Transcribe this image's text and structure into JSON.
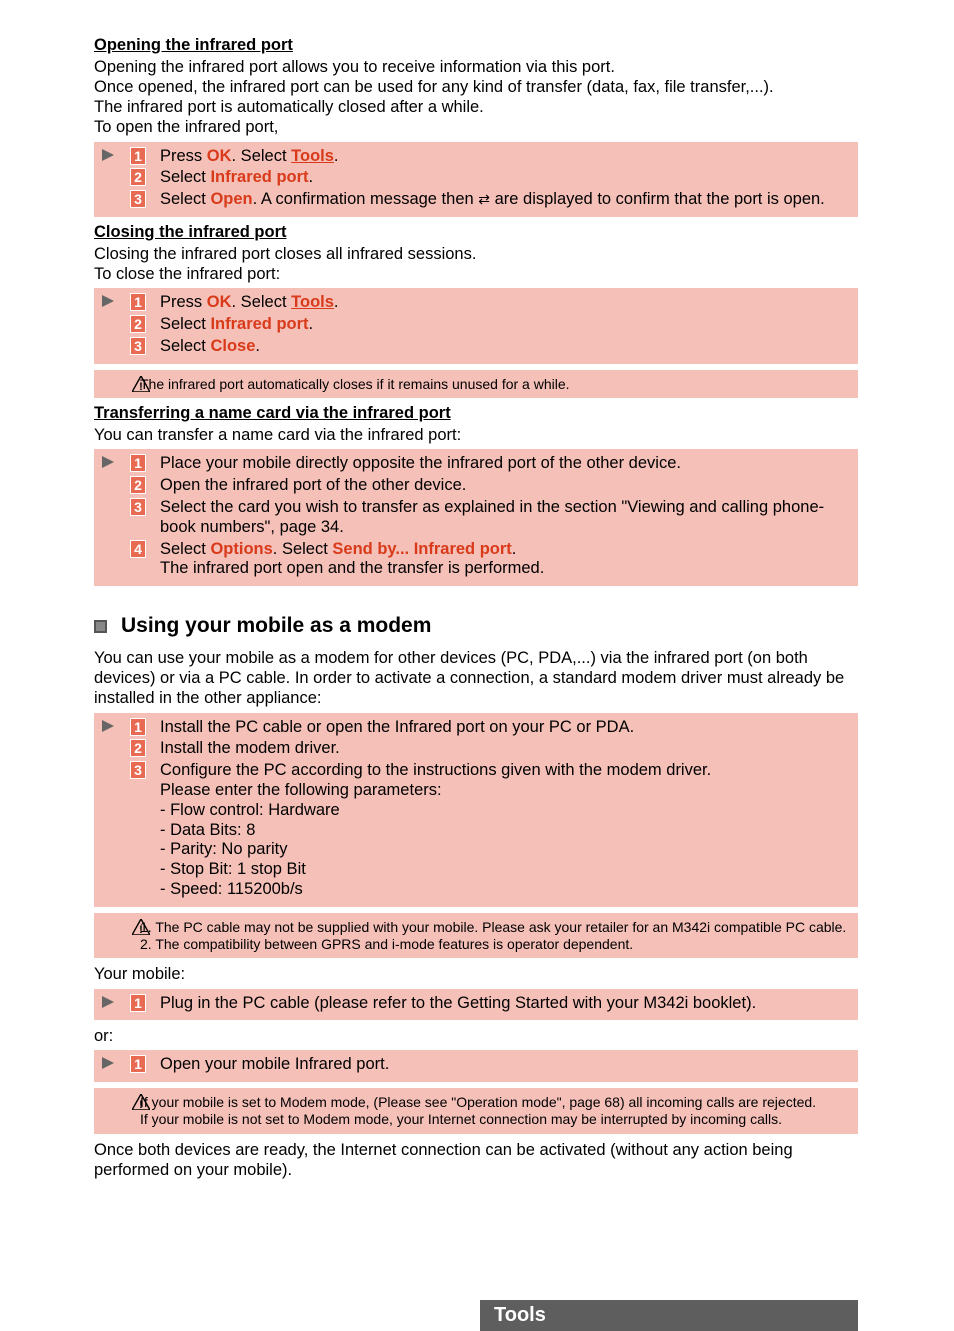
{
  "sections": {
    "opening": {
      "heading": "Opening the infrared port",
      "para": "Opening the infrared port allows you to receive information via this port.\nOnce opened, the infrared port can be used for any kind of transfer (data, fax, file transfer,...).\nThe infrared port is automatically closed after a while.\nTo open the infrared port,",
      "step1_prefix": "Press ",
      "step1_ok": "OK",
      "step1_mid": ". Select ",
      "step1_tools": "Tools",
      "step1_suffix": ".",
      "step2_prefix": "Select ",
      "step2_ir": "Infrared port",
      "step2_suffix": ".",
      "step3_prefix": "Select ",
      "step3_open": "Open",
      "step3_mid": ". A confirmation message then ",
      "step3_suffix": " are displayed to confirm that the port is open."
    },
    "closing": {
      "heading": "Closing the infrared port",
      "para": "Closing the infrared port closes all infrared sessions.\nTo close the infrared port:",
      "step1_prefix": "Press ",
      "step1_ok": "OK",
      "step1_mid": ". Select ",
      "step1_tools": "Tools",
      "step1_suffix": ".",
      "step2_prefix": "Select ",
      "step2_ir": "Infrared port",
      "step2_suffix": ".",
      "step3_prefix": "Select ",
      "step3_close": "Close",
      "step3_suffix": ".",
      "note": "The infrared port automatically closes if it remains unused for a while."
    },
    "transfer": {
      "heading": "Transferring a name card via the infrared port",
      "para": "You can transfer a name card via the infrared port:",
      "step1": "Place your mobile directly opposite the infrared port of the other device.",
      "step2": "Open the infrared port of the other device.",
      "step3": "Select the card you wish to transfer as explained in the section \"Viewing and calling phone-book numbers\", page 34.",
      "step4_prefix": "Select ",
      "step4_options": "Options",
      "step4_mid": ". Select ",
      "step4_sendby": "Send by... Infrared port",
      "step4_suffix": ".",
      "step4_line2": "The infrared port open and the transfer is performed."
    },
    "modem": {
      "title": "Using your mobile as a modem",
      "intro": "You can use your mobile as a modem for other devices (PC, PDA,...) via the infrared port (on both devices) or via a PC cable. In order to activate a connection, a standard modem driver must already be installed in the other appliance:",
      "step1": "Install the PC cable or open the Infrared port on your PC or PDA.",
      "step2": "Install the modem driver.",
      "step3_line1": "Configure the PC according to the instructions given with the modem driver.",
      "step3_line2": "Please enter the following parameters:",
      "step3_b1": "- Flow control: Hardware",
      "step3_b2": "- Data Bits: 8",
      "step3_b3": "- Parity: No parity",
      "step3_b4": "- Stop Bit: 1 stop Bit",
      "step3_b5": "- Speed: 115200b/s",
      "note1": "1. The PC cable may not be supplied with your mobile. Please ask your retailer for an M342i compatible PC cable.",
      "note2": "2. The compatibility between GPRS and i-mode features is operator dependent.",
      "your_mobile": "Your mobile:",
      "ym_step1": "Plug in the PC cable (please refer to the Getting Started with your M342i booklet).",
      "or": "or:",
      "or_step1": "Open your mobile Infrared port.",
      "note3_l1": "If your mobile is set to Modem mode, (Please see \"Operation mode\", page 68) all incoming calls are rejected.",
      "note3_l2": "If your mobile is not set to Modem mode, your Internet connection may be interrupted by incoming calls.",
      "outro": "Once both devices are ready, the Internet connection can be activated (without any action being performed on your mobile)."
    }
  },
  "nums": {
    "n1": "1",
    "n2": "2",
    "n3": "3",
    "n4": "4"
  },
  "footer": "Tools"
}
